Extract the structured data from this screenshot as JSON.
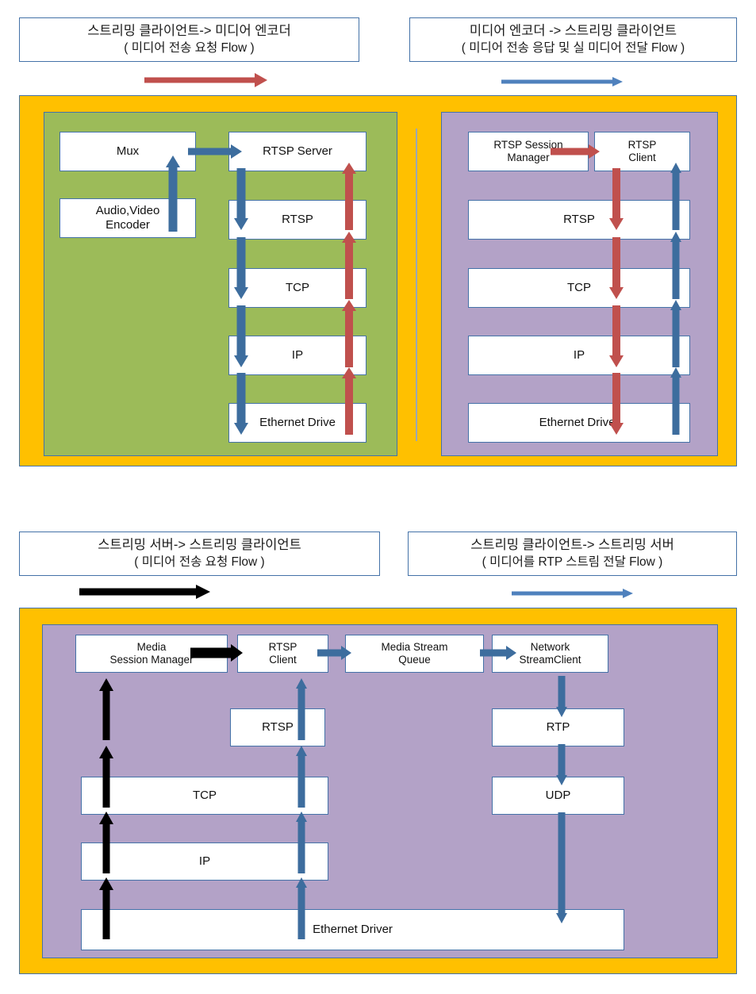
{
  "colors": {
    "orange_panel": "#ffc000",
    "green_panel": "#9cbb59",
    "purple_panel": "#b3a2c7",
    "box_border": "#4472a8",
    "blue_arrow": "#3d6d9e",
    "red_arrow": "#c0504d",
    "black_arrow": "#000000",
    "box_fill": "#ffffff"
  },
  "diagram1": {
    "legends": [
      {
        "line1": "스트리밍 클라이언트-> 미디어 엔코더",
        "line2": "( 미디어 전송 요청 Flow )",
        "arrow_color": "#c0504d",
        "arrow_label": "red-request-arrow"
      },
      {
        "line1": "미디어 엔코더 -> 스트리밍 클라이언트",
        "line2": "( 미디어 전송 응답 및 실 미디어 전달 Flow )",
        "arrow_color": "#4f81bd",
        "arrow_label": "blue-response-arrow"
      }
    ],
    "encoder_side": {
      "panel_name": "media-encoder-stack",
      "nodes": [
        {
          "id": "mux",
          "label": "Mux"
        },
        {
          "id": "av-encoder",
          "label": "Audio,Video\nEncoder"
        },
        {
          "id": "rtsp-server",
          "label": "RTSP Server"
        },
        {
          "id": "rtsp",
          "label": "RTSP"
        },
        {
          "id": "tcp",
          "label": "TCP"
        },
        {
          "id": "ip",
          "label": "IP"
        },
        {
          "id": "ethernet",
          "label": "Ethernet Drive"
        }
      ]
    },
    "client_side": {
      "panel_name": "streaming-client-stack",
      "nodes": [
        {
          "id": "rtsp-session-manager",
          "label": "RTSP Session\nManager"
        },
        {
          "id": "rtsp-client",
          "label": "RTSP\nClient"
        },
        {
          "id": "rtsp",
          "label": "RTSP"
        },
        {
          "id": "tcp",
          "label": "TCP"
        },
        {
          "id": "ip",
          "label": "IP"
        },
        {
          "id": "ethernet",
          "label": "Ethernet Driver"
        }
      ]
    }
  },
  "diagram2": {
    "legends": [
      {
        "line1": "스트리밍 서버-> 스트리밍 클라이언트",
        "line2": "( 미디어 전송 요청 Flow )",
        "arrow_color": "#000000",
        "arrow_label": "black-request-arrow"
      },
      {
        "line1": "스트리밍 클라이언트-> 스트리밍 서버",
        "line2": "(  미디어를 RTP 스트림 전달 Flow )",
        "arrow_color": "#4f81bd",
        "arrow_label": "blue-rtp-arrow"
      }
    ],
    "client_stack": {
      "panel_name": "streaming-client-full-stack",
      "nodes": [
        {
          "id": "media-session-manager",
          "label": "Media\nSession Manager"
        },
        {
          "id": "rtsp-client",
          "label": "RTSP\nClient"
        },
        {
          "id": "media-stream-queue",
          "label": "Media Stream\nQueue"
        },
        {
          "id": "network-stream-client",
          "label": "Network\nStreamClient"
        },
        {
          "id": "rtsp",
          "label": "RTSP"
        },
        {
          "id": "rtp",
          "label": "RTP"
        },
        {
          "id": "tcp",
          "label": "TCP"
        },
        {
          "id": "udp",
          "label": "UDP"
        },
        {
          "id": "ip",
          "label": "IP"
        },
        {
          "id": "ethernet",
          "label": "Ethernet Driver"
        }
      ]
    }
  }
}
